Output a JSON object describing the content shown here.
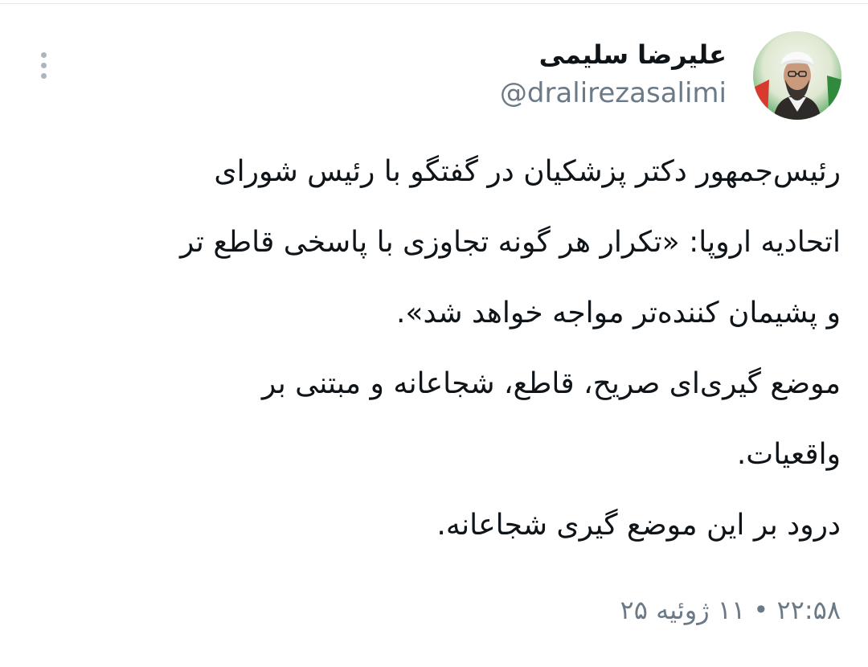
{
  "author": {
    "display_name": "علیرضا سلیمی",
    "handle": "@dralirezasalimi",
    "avatar_icon": "profile-photo-icon"
  },
  "menu": {
    "icon": "more-vertical-icon"
  },
  "tweet": {
    "lines": [
      "رئیس‌جمهور دکتر پزشکیان در گفتگو با رئیس شورای",
      "اتحادیه اروپا: «تکرار هر گونه تجاوزی با پاسخی قاطع تر",
      "و پشیمان کننده‌تر مواجه خواهد شد».",
      " موضع گیری‌ای صریح، قاطع، شجاعانه و مبتنی بر",
      "واقعیات.",
      "درود بر این موضع گیری شجاعانه."
    ],
    "timestamp": "۲۲:۵۸ • ۱۱ ژوئیه ۲۵"
  },
  "colors": {
    "text": "#0f1419",
    "secondary": "#6b7a86",
    "menu_dots": "#a9b6c2"
  }
}
